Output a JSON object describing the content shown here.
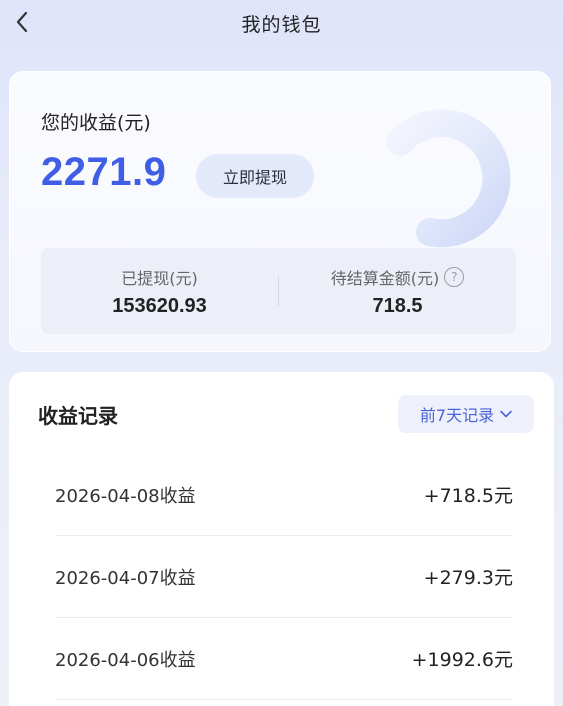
{
  "header": {
    "title": "我的钱包",
    "back_icon": "chevron-left-icon"
  },
  "earnings": {
    "label": "您的收益(元)",
    "amount": "2271.9",
    "withdraw_label": "立即提现",
    "withdrawn_label": "已提现(元)",
    "withdrawn_value": "153620.93",
    "pending_label": "待结算金额(元)",
    "pending_value": "718.5",
    "help_icon": "question-circle-icon"
  },
  "records": {
    "title": "收益记录",
    "filter_label": "前7天记录",
    "filter_icon": "chevron-down-icon",
    "items": [
      {
        "date": "2026-04-08收益",
        "amount": "+718.5元"
      },
      {
        "date": "2026-04-07收益",
        "amount": "+279.3元"
      },
      {
        "date": "2026-04-06收益",
        "amount": "+1992.6元"
      }
    ]
  },
  "colors": {
    "accent": "#3f5ee5",
    "button_bg": "#e3e8fb",
    "filter_text": "#4a63d6"
  }
}
